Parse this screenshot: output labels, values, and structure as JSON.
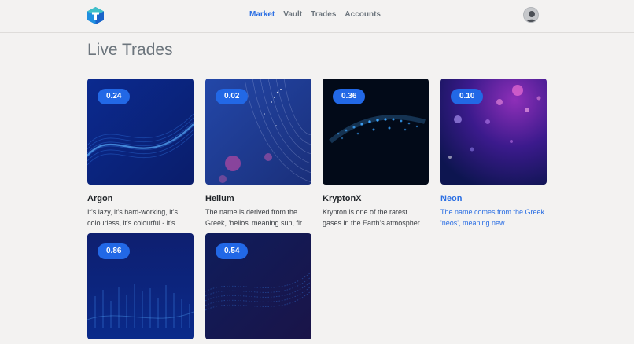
{
  "nav": {
    "items": [
      {
        "label": "Market",
        "active": true
      },
      {
        "label": "Vault",
        "active": false
      },
      {
        "label": "Trades",
        "active": false
      },
      {
        "label": "Accounts",
        "active": false
      }
    ]
  },
  "page": {
    "title": "Live Trades"
  },
  "cards": [
    {
      "price": "0.24",
      "name": "Argon",
      "desc_1": "It's lazy, it's hard-working, it's",
      "desc_2": "colourless, it's colourful - it's..."
    },
    {
      "price": "0.02",
      "name": "Helium",
      "desc_1": "The name is derived from the",
      "desc_2": "Greek, 'helios' meaning sun, fir..."
    },
    {
      "price": "0.36",
      "name": "KryptonX",
      "desc_1": "Krypton is one of the rarest",
      "desc_2": "gases in the Earth's atmospher..."
    },
    {
      "price": "0.10",
      "name": "Neon",
      "desc_1": "The name comes from the Greek",
      "desc_2": "'neos', meaning new."
    },
    {
      "price": "0.86",
      "name": "",
      "desc_1": "",
      "desc_2": ""
    },
    {
      "price": "0.54",
      "name": "",
      "desc_1": "",
      "desc_2": ""
    }
  ],
  "colors": {
    "accent": "#2268e6",
    "link": "#2b6fe3",
    "background": "#f3f2f1"
  },
  "icons": {
    "logo": "cube-logo-icon",
    "avatar": "user-avatar-icon"
  }
}
